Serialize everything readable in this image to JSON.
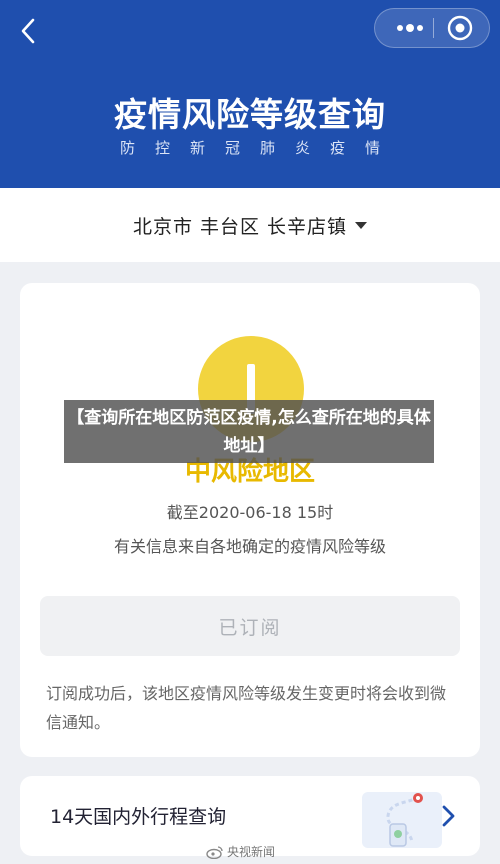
{
  "header": {
    "title": "疫情风险等级查询",
    "subtitle": "防控新冠肺炎疫情"
  },
  "location": {
    "text": "北京市 丰台区 长辛店镇"
  },
  "risk": {
    "level": "中风险地区",
    "as_of": "截至2020-06-18 15时",
    "source_note": "有关信息来自各地确定的疫情风险等级",
    "color": "#f2d43f"
  },
  "subscribe": {
    "label": "已订阅"
  },
  "notice": "订阅成功后，该地区疫情风险等级发生变更时将会收到微信通知。",
  "trip": {
    "label": "14天国内外行程查询"
  },
  "overlay": {
    "text": "【查询所在地区防范区疫情,怎么查所在地的具体地址】"
  },
  "watermark": {
    "text": "央视新闻"
  },
  "colors": {
    "header_bg": "#1f4fae",
    "risk_yellow": "#f2d43f",
    "accent_blue": "#1f4fae"
  },
  "icons": [
    "back-icon",
    "more-icon",
    "close-icon",
    "dropdown-caret-icon",
    "risk-level-icon",
    "trip-map-icon",
    "chevron-right-icon",
    "weibo-logo"
  ]
}
